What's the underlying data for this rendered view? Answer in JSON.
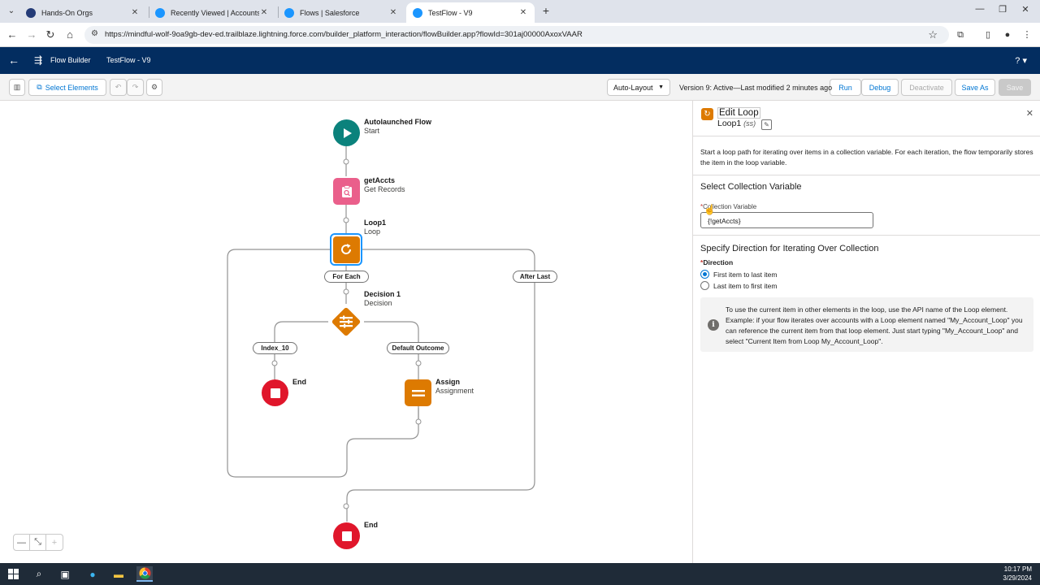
{
  "browser": {
    "tabs": [
      {
        "title": "Hands-On Orgs",
        "active": false
      },
      {
        "title": "Recently Viewed | Accounts | S",
        "active": false
      },
      {
        "title": "Flows | Salesforce",
        "active": false
      },
      {
        "title": "TestFlow - V9",
        "active": true
      }
    ],
    "url": "https://mindful-wolf-9oa9gb-dev-ed.trailblaze.lightning.force.com/builder_platform_interaction/flowBuilder.app?flowId=301aj00000AxoxVAAR"
  },
  "header": {
    "app_name": "Flow Builder",
    "flow_name": "TestFlow - V9",
    "help": "?"
  },
  "toolbar": {
    "select_elements": "Select Elements",
    "auto_layout": "Auto-Layout",
    "version_status": "Version 9: Active—Last modified 2 minutes ago",
    "run": "Run",
    "debug": "Debug",
    "deactivate": "Deactivate",
    "save_as": "Save As",
    "save": "Save"
  },
  "canvas": {
    "start": {
      "title": "Autolaunched Flow",
      "type": "Start"
    },
    "get_records": {
      "title": "getAccts",
      "type": "Get Records"
    },
    "loop": {
      "title": "Loop1",
      "type": "Loop"
    },
    "for_each": "For Each",
    "after_last": "After Last",
    "decision": {
      "title": "Decision 1",
      "type": "Decision"
    },
    "outcome_1": "Index_10",
    "outcome_default": "Default Outcome",
    "end_inner": {
      "title": "End"
    },
    "assign": {
      "title": "Assign",
      "type": "Assignment"
    },
    "end_outer": {
      "title": "End"
    }
  },
  "panel": {
    "title": "Edit Loop",
    "api_name": "Loop1",
    "api_suffix": "(ss)",
    "description": "Start a loop path for iterating over items in a collection variable. For each iteration, the flow temporarily stores the item in the loop variable.",
    "collection_section": "Select Collection Variable",
    "collection_label": "Collection Variable",
    "collection_value": "{!getAccts}",
    "direction_section": "Specify Direction for Iterating Over Collection",
    "direction_label": "Direction",
    "option_first": "First item to last item",
    "option_last": "Last item to first item",
    "info": "To use the current item in other elements in the loop, use the API name of the Loop element. Example: if your flow iterates over accounts with a Loop element named \"My_Account_Loop\" you can reference the current item from that loop element. Just start typing \"My_Account_Loop\" and select \"Current Item from Loop My_Account_Loop\"."
  },
  "taskbar": {
    "time": "10:17 PM",
    "date": "3/29/2024"
  },
  "colors": {
    "sf_header": "#032d60",
    "accent": "#0176d3",
    "start": "#0b827c",
    "get_records": "#ea5f8b",
    "loop_assign": "#dd7a01",
    "end": "#e0162b"
  }
}
